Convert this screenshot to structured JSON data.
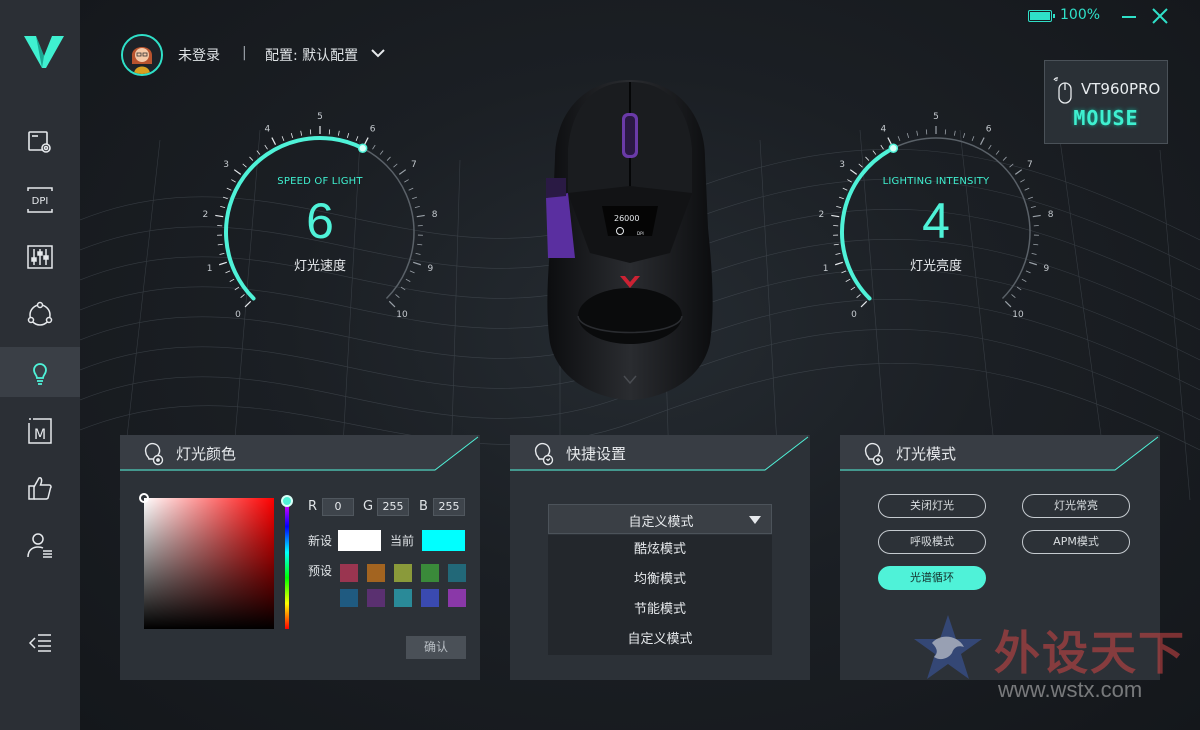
{
  "window": {
    "battery_text": "100%",
    "battery_level": 100
  },
  "header": {
    "user_status": "未登录",
    "separator": "|",
    "profile_label": "配置: 默认配置"
  },
  "device": {
    "name": "VT960PRO",
    "type": "MOUSE"
  },
  "sidebar": {
    "items": [
      {
        "name": "settings"
      },
      {
        "name": "dpi",
        "label": "DPI"
      },
      {
        "name": "equalizer"
      },
      {
        "name": "macro-cycle"
      },
      {
        "name": "lighting",
        "active": true
      },
      {
        "name": "macro",
        "label": "M"
      },
      {
        "name": "like"
      },
      {
        "name": "user"
      }
    ]
  },
  "gauges": {
    "speed": {
      "label_en": "SPEED OF LIGHT",
      "label_zh": "灯光速度",
      "value": "6",
      "value_num": 6,
      "min": 0,
      "max": 10,
      "ticks": [
        "0",
        "1",
        "2",
        "3",
        "4",
        "5",
        "6",
        "7",
        "8",
        "9",
        "10"
      ]
    },
    "brightness": {
      "label_en": "LIGHTING INTENSITY",
      "label_zh": "灯光亮度",
      "value": "4",
      "value_num": 4,
      "min": 0,
      "max": 10,
      "ticks": [
        "0",
        "1",
        "2",
        "3",
        "4",
        "5",
        "6",
        "7",
        "8",
        "9",
        "10"
      ]
    }
  },
  "mouse_display": {
    "dpi": "26000",
    "unit": "DPI"
  },
  "color_panel": {
    "title": "灯光颜色",
    "r_label": "R",
    "r": "0",
    "g_label": "G",
    "g": "255",
    "b_label": "B",
    "b": "255",
    "new_label": "新设",
    "new_color": "#ffffff",
    "current_label": "当前",
    "current_color": "#00ffff",
    "preset_label": "预设",
    "presets": [
      "#9a3550",
      "#a36420",
      "#8a9a3a",
      "#3a8a3a",
      "#226878",
      "#1f5a80",
      "#5a3070",
      "#2a8a98",
      "#3a4ab0",
      "#8a38a8"
    ],
    "confirm": "确认"
  },
  "shortcut_panel": {
    "title": "快捷设置",
    "selected": "自定义模式",
    "options": [
      "酷炫模式",
      "均衡模式",
      "节能模式",
      "自定义模式"
    ]
  },
  "mode_panel": {
    "title": "灯光模式",
    "modes": [
      {
        "label": "关闭灯光",
        "active": false
      },
      {
        "label": "灯光常亮",
        "active": false
      },
      {
        "label": "呼吸模式",
        "active": false
      },
      {
        "label": "APM模式",
        "active": false
      },
      {
        "label": "光谱循环",
        "active": true
      }
    ]
  },
  "watermark": {
    "text": "外设天下",
    "url": "www.wstx.com"
  },
  "colors": {
    "accent": "#4ff2d8",
    "sidebar_bg": "#2b2f35",
    "panel_bg": "#2c3137"
  }
}
